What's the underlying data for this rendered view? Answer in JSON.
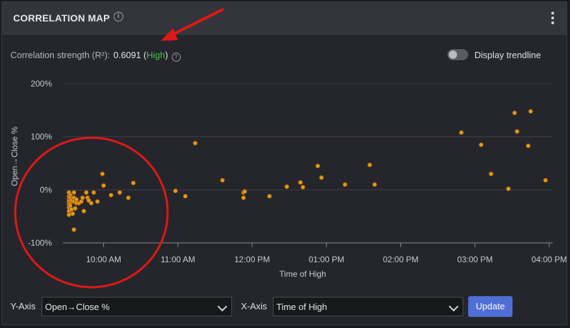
{
  "header": {
    "title": "CORRELATION MAP",
    "info_icon": "info-icon",
    "menu_icon": "kebab-menu-icon"
  },
  "correlation": {
    "label": "Correlation strength (R²):",
    "value": "0.6091",
    "paren_open": " (",
    "strength": "High",
    "paren_close": ")",
    "help_icon": "question-icon"
  },
  "trendline": {
    "label": "Display trendline",
    "enabled": false
  },
  "colors": {
    "accent": "#4f6fd6",
    "point": "#e69a1c",
    "high": "#4cbf4f",
    "annotation": "#e01818"
  },
  "chart_data": {
    "type": "scatter",
    "xlabel": "Time of High",
    "ylabel": "Open→Close %",
    "y_ticks": [
      "200%",
      "100%",
      "0%",
      "-100%"
    ],
    "y_tick_values": [
      200,
      100,
      0,
      -100
    ],
    "x_ticks": [
      "10:00 AM",
      "11:00 AM",
      "12:00 PM",
      "01:00 PM",
      "02:00 PM",
      "03:00 PM",
      "04:00 PM"
    ],
    "x_tick_values": [
      "10:00",
      "11:00",
      "12:00",
      "13:00",
      "14:00",
      "15:00",
      "16:00"
    ],
    "xlim": [
      "09:30",
      "16:00"
    ],
    "ylim": [
      -100,
      200
    ],
    "grid": true,
    "points": [
      [
        "09:32",
        -5
      ],
      [
        "09:32",
        -12
      ],
      [
        "09:32",
        -18
      ],
      [
        "09:32",
        -22
      ],
      [
        "09:32",
        -27
      ],
      [
        "09:32",
        -33
      ],
      [
        "09:32",
        -40
      ],
      [
        "09:32",
        -47
      ],
      [
        "09:33",
        -10
      ],
      [
        "09:33",
        -15
      ],
      [
        "09:33",
        -25
      ],
      [
        "09:33",
        -30
      ],
      [
        "09:34",
        -20
      ],
      [
        "09:34",
        -37
      ],
      [
        "09:35",
        -45
      ],
      [
        "09:36",
        -5
      ],
      [
        "09:36",
        -15
      ],
      [
        "09:36",
        -22
      ],
      [
        "09:36",
        -75
      ],
      [
        "09:37",
        -35
      ],
      [
        "09:38",
        -18
      ],
      [
        "09:38",
        -25
      ],
      [
        "09:40",
        -25
      ],
      [
        "09:42",
        -22
      ],
      [
        "09:43",
        -15
      ],
      [
        "09:44",
        -40
      ],
      [
        "09:46",
        -5
      ],
      [
        "09:47",
        -15
      ],
      [
        "09:48",
        -20
      ],
      [
        "09:50",
        -25
      ],
      [
        "09:52",
        -5
      ],
      [
        "09:55",
        -22
      ],
      [
        "09:59",
        30
      ],
      [
        "10:00",
        8
      ],
      [
        "10:06",
        -10
      ],
      [
        "10:13",
        -5
      ],
      [
        "10:20",
        -15
      ],
      [
        "10:24",
        13
      ],
      [
        "10:58",
        -2
      ],
      [
        "11:06",
        -12
      ],
      [
        "11:14",
        88
      ],
      [
        "11:36",
        18
      ],
      [
        "11:53",
        -5
      ],
      [
        "11:54",
        -3
      ],
      [
        "11:53",
        -15
      ],
      [
        "12:14",
        -12
      ],
      [
        "12:28",
        6
      ],
      [
        "12:39",
        14
      ],
      [
        "12:41",
        5
      ],
      [
        "12:53",
        45
      ],
      [
        "12:56",
        23
      ],
      [
        "13:15",
        10
      ],
      [
        "13:35",
        47
      ],
      [
        "13:39",
        10
      ],
      [
        "14:49",
        108
      ],
      [
        "15:05",
        85
      ],
      [
        "15:13",
        30
      ],
      [
        "15:27",
        2
      ],
      [
        "15:32",
        145
      ],
      [
        "15:34",
        110
      ],
      [
        "15:43",
        83
      ],
      [
        "15:45",
        148
      ],
      [
        "15:57",
        18
      ]
    ]
  },
  "annotations": {
    "arrow": "red-arrow-annotation",
    "circle": "red-circle-annotation"
  },
  "controls": {
    "y_axis_label": "Y-Axis",
    "y_axis_value": "Open→Close %",
    "x_axis_label": "X-Axis",
    "x_axis_value": "Time of High",
    "update_label": "Update"
  }
}
